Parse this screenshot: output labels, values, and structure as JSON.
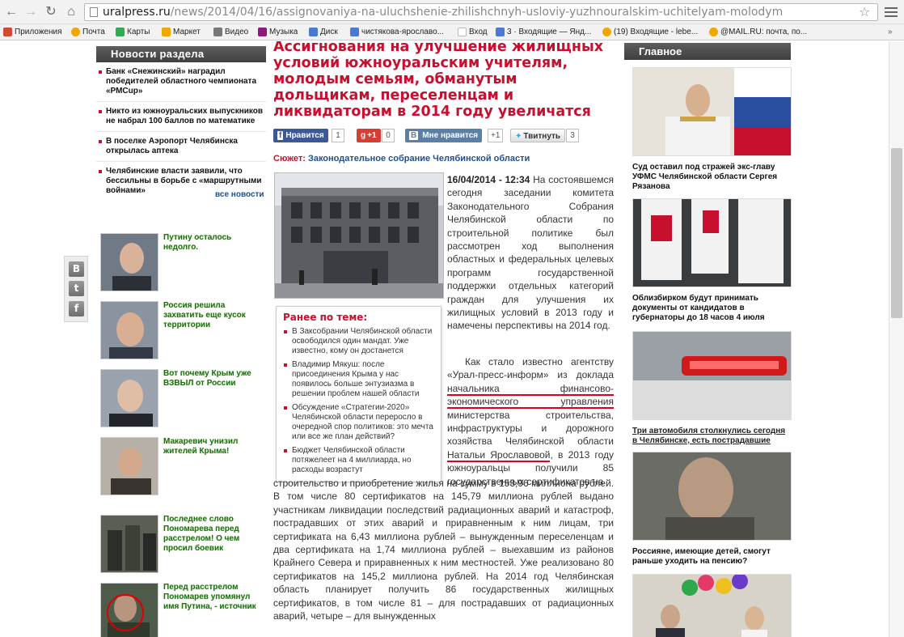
{
  "browser": {
    "url_host": "uralpress.ru",
    "url_path": "/news/2014/04/16/assignovaniya-na-uluchshenie-zhilishchnyh-usloviy-yuzhnouralskim-uchitelyam-molodym",
    "bookmarks": [
      {
        "label": "Приложения",
        "color": "#d24a32"
      },
      {
        "label": "Почта",
        "color": "#f0a800"
      },
      {
        "label": "Карты",
        "color": "#34a853"
      },
      {
        "label": "Маркет",
        "color": "#f0a800"
      },
      {
        "label": "Видео",
        "color": "#777777"
      },
      {
        "label": "Музыка",
        "color": "#8b1a7a"
      },
      {
        "label": "Диск",
        "color": "#4a7bd0"
      },
      {
        "label": "чистякова-ярославо...",
        "color": "#4a7bd0"
      },
      {
        "label": "Вход",
        "color": "#bbbbbb"
      },
      {
        "label": "3 · Входящие — Янд...",
        "color": "#4a7bd0"
      },
      {
        "label": "(19) Входящие - lebe...",
        "color": "#f0a800"
      },
      {
        "label": "@MAIL.RU: почта, по...",
        "color": "#f0a800"
      }
    ],
    "bookmarks_more": "»"
  },
  "left": {
    "section_title": "Новости раздела",
    "news": [
      "Банк «Снежинский» наградил победителей областного чемпионата «РМCup»",
      "Никто из южноуральских выпускников не набрал 100 баллов по математике",
      "В поселке Аэропорт Челябинска открылась аптека",
      "Челябинские власти заявили, что бессильны в борьбе с «маршрутными войнами»"
    ],
    "all_news": "все новости",
    "share": [
      "B",
      "t",
      "f"
    ],
    "promos": [
      "Путину осталось недолго.",
      "Россия решила захватить еще кусок территории",
      "Вот почему Крым уже ВЗВЫЛ от России",
      "Макаревич унизил жителей Крыма!",
      "Последнее слово Пономарева перед расстрелом! О чем просил боевик",
      "Перед расстрелом Пономарев упомянул имя Путина, - источник"
    ]
  },
  "article": {
    "title": "Ассигнования на улучшение жилищных условий южноуральским учителям, молодым семьям, обманутым дольщикам, переселенцам и ликвидаторам в 2014 году увеличатся",
    "social": {
      "fb_label": "Нравится",
      "fb_count": "1",
      "gplus_label": "+1",
      "gplus_count": "0",
      "vk_label": "Мне нравится",
      "vk_count": "+1",
      "tw_label": "Твитнуть",
      "tw_count": "3"
    },
    "story_label": "Сюжет:",
    "story_value": "Законодательное собрание Челябинской области",
    "related_title": "Ранее по теме:",
    "related": [
      "В Заксобрании Челябинской области освободился один мандат. Уже известно, кому он достанется",
      "Владимир Мякуш: после присоединения Крыма у нас появилось больше энтузиазма в решении проблем нашей области",
      "Обсуждение «Стратегии-2020» Челябинской области переросло в очередной спор политиков: это мечта или все же план действий?",
      "Бюджет Челябинской области потяжелеет на 4 миллиарда, но расходы возрастут"
    ],
    "date": "16/04/2014 - 12:34",
    "p1": "На состоявшемся сегодня заседании комитета Законодательного Собрания Челябинской области по строительной политике был рассмотрен ход выполнения областных и федеральных целевых программ государственной поддержки отдельных категорий граждан для улучшения их жилищных условий в 2013 году и намечены перспективы на 2014 год.",
    "p2_a": "Как стало известно агентству «Урал-пресс-информ» из доклада",
    "p2_hl1": "начальника финансово-экономического управления",
    "p2_b": "министерства строительства, инфраструктуры и дорожного хозяйства Челябинской области",
    "p2_hl2": "Натальи Ярославовой",
    "p2_c": ", в 2013 году южноуральцы получили 85 государственных сертификатов на",
    "p3": "строительство и приобретение жилья на сумму в 153,96 миллиона рублей. В том числе 80 сертификатов на 145,79 миллиона рублей выдано участникам ликвидации последствий радиационных аварий и катастроф, пострадавших от этих аварий и приравненным к ним лицам, три сертификата на 6,43 миллиона рублей – вынужденным переселенцам и два сертификата на 1,74 миллиона рублей – выехавшим из районов Крайнего Севера и приравненных к ним местностей. Уже реализовано 80 сертификатов на 145,2 миллиона рублей. На 2014 год Челябинская область планирует получить 86 государственных жилищных сертификатов, в том числе 81 – для пострадавших от радиационных аварий, четыре – для вынужденных"
  },
  "right": {
    "title": "Главное",
    "cards": [
      "Суд оставил под стражей экс-главу УФМС Челябинской области Сергея Рязанова",
      "Облизбирком будут принимать документы от кандидатов в губернаторы до 18 часов 4 июля",
      "Три автомобиля столкнулись сегодня в Челябинске, есть пострадавшие",
      "Россияне, имеющие детей, смогут раньше уходить на пенсию?"
    ]
  }
}
